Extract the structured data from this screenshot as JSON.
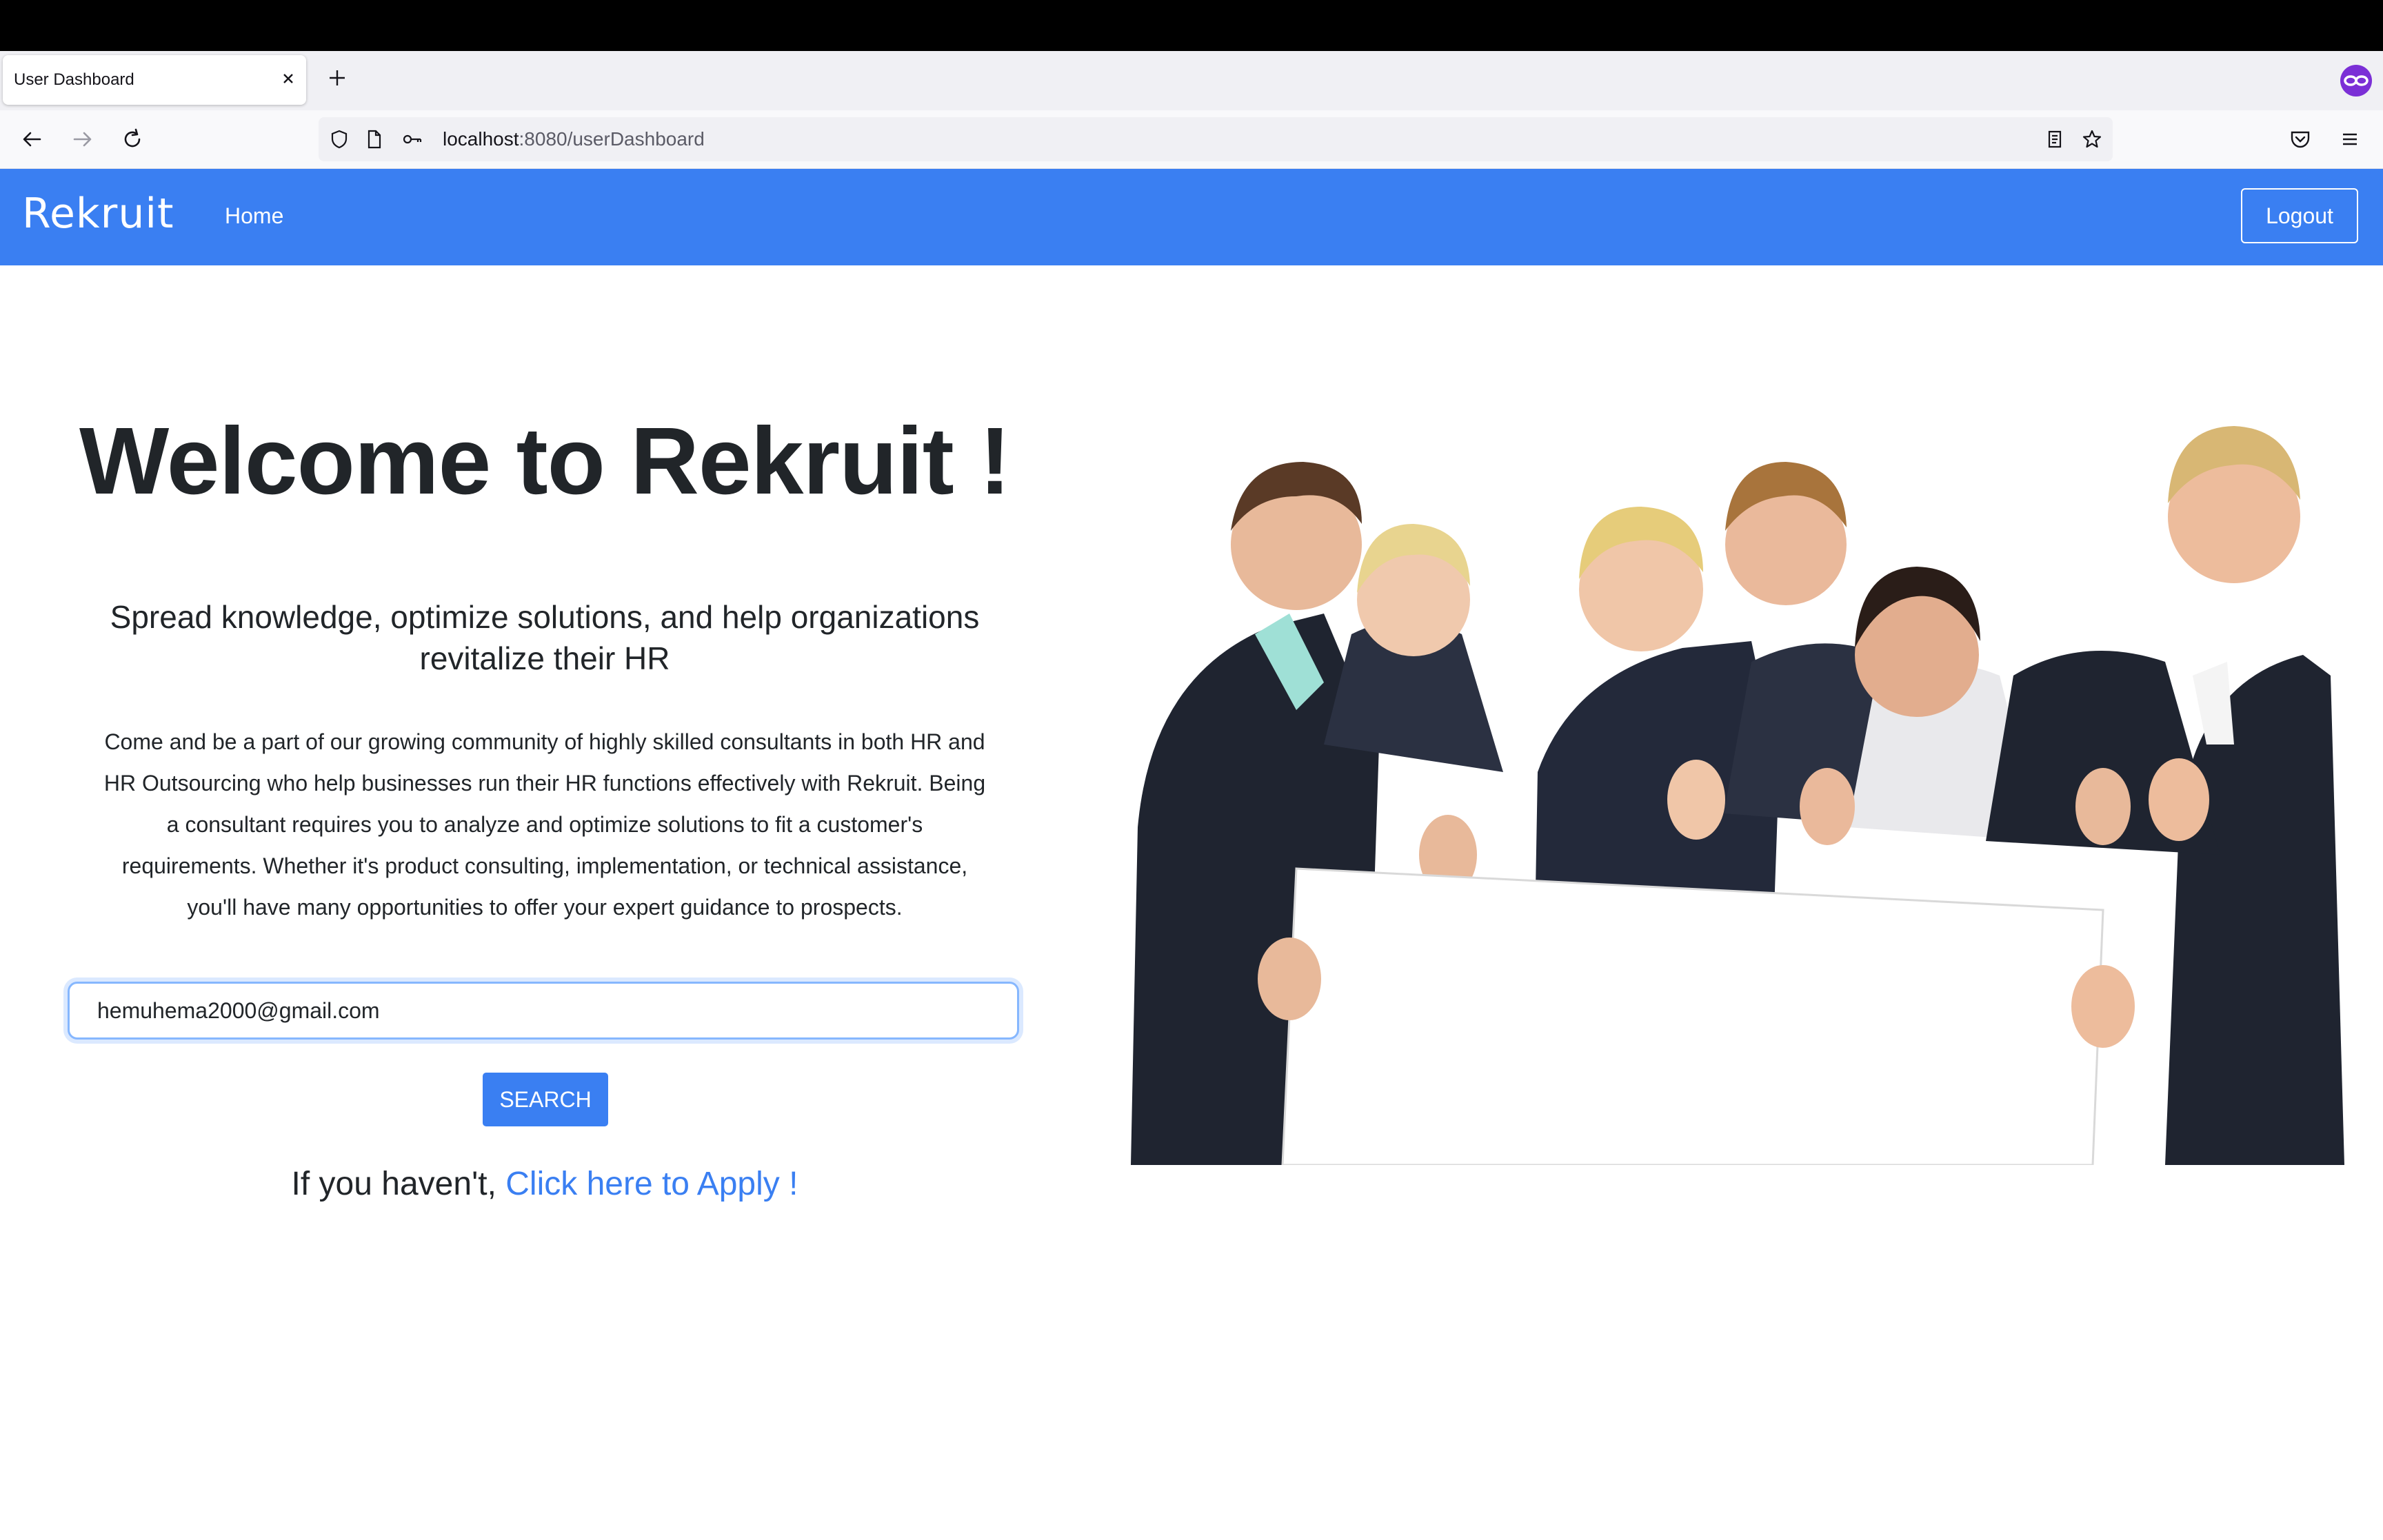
{
  "browser": {
    "tab_title": "User Dashboard",
    "url_host": "localhost",
    "url_path": ":8080/userDashboard"
  },
  "navbar": {
    "brand": "Rekruit",
    "home_link": "Home",
    "logout_label": "Logout"
  },
  "main": {
    "title": "Welcome to Rekruit !",
    "subtitle_line1": "Spread knowledge, optimize solutions, and help organizations",
    "subtitle_line2": "revitalize their HR",
    "body_lines": [
      "Come and be a part of our growing community of highly skilled consultants in both HR and",
      "HR Outsourcing who help businesses run their HR functions effectively with Rekruit. Being",
      "a consultant requires you to analyze and optimize solutions to fit a customer's",
      "requirements. Whether it's product consulting, implementation, or technical assistance,",
      "you'll have many opportunities to offer your expert guidance to prospects."
    ],
    "email_value": "hemuhema2000@gmail.com",
    "search_label": "SEARCH",
    "apply_prefix": "If you haven't, ",
    "apply_link": "Click here to Apply !"
  },
  "colors": {
    "brand_blue": "#3a7ff2",
    "text_dark": "#212529"
  }
}
